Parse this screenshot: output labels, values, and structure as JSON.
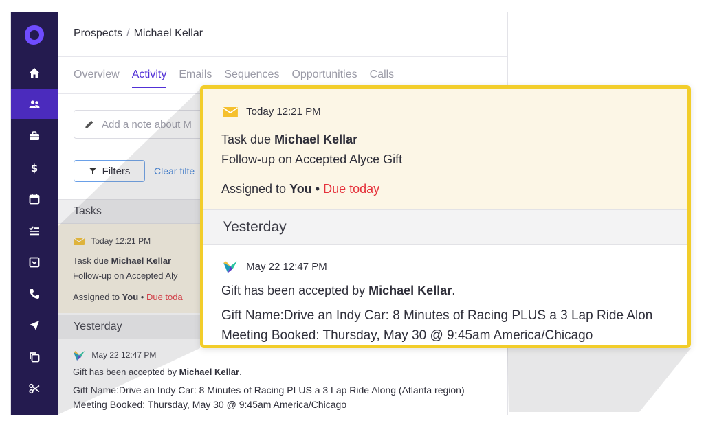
{
  "breadcrumb": {
    "parent": "Prospects",
    "separator": "/",
    "current": "Michael Kellar"
  },
  "tabs": [
    "Overview",
    "Activity",
    "Emails",
    "Sequences",
    "Opportunities",
    "Calls"
  ],
  "active_tab": "Activity",
  "note": {
    "placeholder": "Add a note about M"
  },
  "filters": {
    "button_label": "Filters",
    "clear_label": "Clear filte"
  },
  "sidebar": {
    "active_item": "people",
    "icons": [
      "outreach-logo-icon",
      "home-icon",
      "people-icon",
      "briefcase-icon",
      "dollar-icon",
      "calendar-icon",
      "checklist-icon",
      "inbox-icon",
      "phone-icon",
      "send-icon",
      "copy-icon",
      "scissors-icon"
    ]
  },
  "colors": {
    "sidebar": "#241b4f",
    "active_nav": "#4b2bbd",
    "accent": "#5130d6",
    "highlight_border": "#f2cd2a",
    "due_red": "#e5323c",
    "task_bg": "#faf5e4"
  },
  "tasks_section": {
    "heading": "Tasks",
    "time": "Today 12:21 PM",
    "task_prefix": "Task due",
    "prospect": "Michael Kellar",
    "description": "Follow-up on Accepted Aly",
    "assigned_prefix": "Assigned to",
    "assignee": "You",
    "bullet": "•",
    "due": "Due toda"
  },
  "yesterday_section": {
    "heading": "Yesterday",
    "time": "May 22 12:47 PM",
    "accepted_prefix": "Gift has been accepted by",
    "prospect": "Michael Kellar",
    "period": ".",
    "gift_name": "Gift Name:Drive an Indy Car: 8 Minutes of Racing PLUS a 3 Lap Ride Along (Atlanta region)",
    "meeting": "Meeting Booked: Thursday, May 30 @ 9:45am America/Chicago"
  },
  "zoom": {
    "time": "Today 12:21 PM",
    "task_prefix": "Task due",
    "prospect": "Michael Kellar",
    "description": "Follow-up on Accepted Alyce Gift",
    "assigned_prefix": "Assigned to",
    "assignee": "You",
    "bullet": "•",
    "due": "Due today",
    "yesterday": "Yesterday",
    "y_time": "May 22 12:47 PM",
    "accepted_prefix": "Gift has been accepted by",
    "y_prospect": "Michael Kellar",
    "period": ".",
    "gift_name": "Gift Name:Drive an Indy Car: 8 Minutes of Racing PLUS a 3 Lap Ride Alon",
    "meeting": "Meeting Booked: Thursday, May 30 @ 9:45am America/Chicago"
  }
}
